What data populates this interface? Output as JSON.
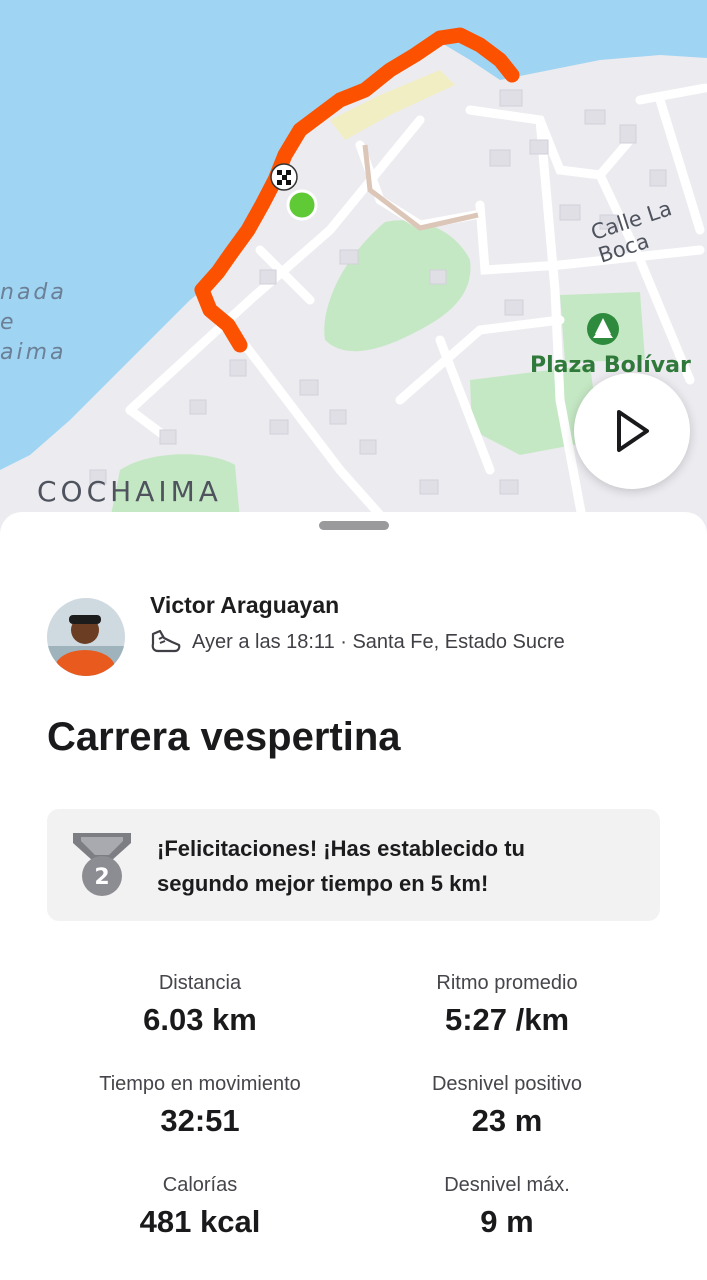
{
  "map": {
    "labels": {
      "bay_line1": "nada",
      "bay_line2": "e",
      "bay_line3": "aima",
      "town": "COCHAIMA",
      "street": "Calle La Boca",
      "plaza": "Plaza Bolívar"
    },
    "colors": {
      "water": "#9fd4f2",
      "land": "#ecebf0",
      "route": "#fc5200",
      "start_marker": "#5fc936",
      "park": "#c5e8c4"
    },
    "play_button_icon": "play-icon"
  },
  "activity": {
    "athlete_name": "Victor Araguayan",
    "sport_icon": "running-shoe-icon",
    "datetime_location": "Ayer a las 18:11 · Santa Fe, Estado Sucre",
    "title": "Carrera vespertina",
    "achievement": {
      "icon": "silver-medal-icon",
      "medal_rank": "2",
      "text": "¡Felicitaciones! ¡Has establecido tu segundo mejor tiempo en 5 km!"
    },
    "stats": [
      {
        "label": "Distancia",
        "value": "6.03 km"
      },
      {
        "label": "Ritmo promedio",
        "value": "5:27 /km"
      },
      {
        "label": "Tiempo en movimiento",
        "value": "32:51"
      },
      {
        "label": "Desnivel positivo",
        "value": "23 m"
      },
      {
        "label": "Calorías",
        "value": "481 kcal"
      },
      {
        "label": "Desnivel máx.",
        "value": "9 m"
      }
    ]
  }
}
